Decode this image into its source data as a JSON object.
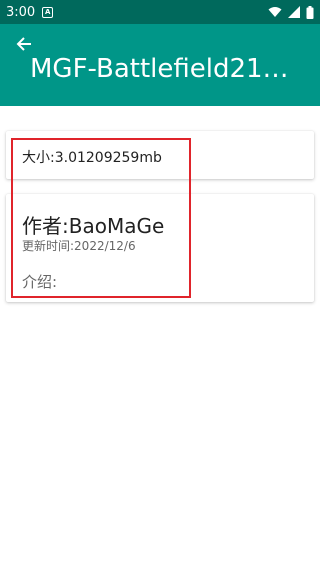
{
  "status_bar": {
    "time": "3:00",
    "notification_icon": "A",
    "icons": [
      "wifi-icon",
      "signal-icon",
      "battery-icon"
    ]
  },
  "app_bar": {
    "title": "MGF-Battlefield21…",
    "back_icon": "arrow-left-icon"
  },
  "details": {
    "size": "大小:3.01209259mb",
    "author": "作者:BaoMaGe",
    "updated": "更新时间:2022/12/6",
    "intro": "介绍:"
  },
  "colors": {
    "status_bar": "#00695c",
    "app_bar": "#009688",
    "highlight": "#e0242b"
  }
}
